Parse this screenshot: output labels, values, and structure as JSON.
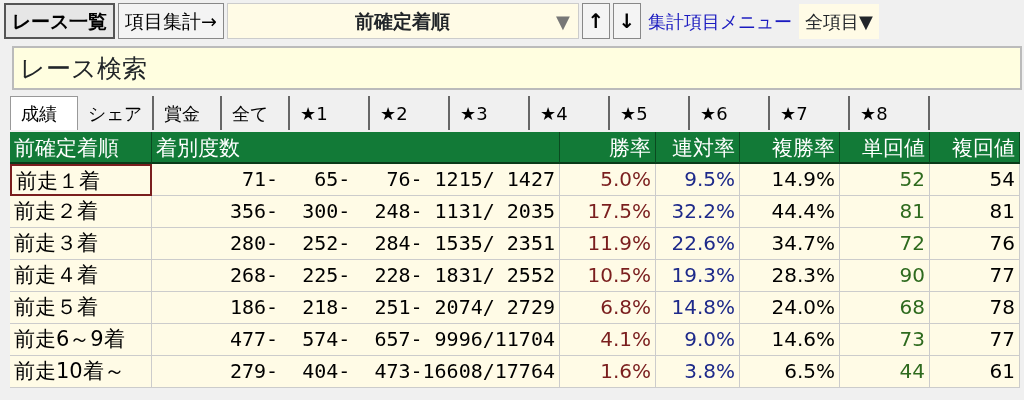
{
  "toolbar": {
    "buttons": [
      {
        "label": "レース一覧",
        "selected": true
      },
      {
        "label": "項目集計→",
        "selected": false
      }
    ],
    "sort_field": {
      "value": "前確定着順",
      "arrow": "▼"
    },
    "sort_buttons": [
      "↑",
      "↓"
    ],
    "menu_link": "集計項目メニュー",
    "all_items": "全項目▼"
  },
  "search": {
    "value": "レース検索"
  },
  "tabs": [
    {
      "label": "成績",
      "selected": true
    },
    {
      "label": "シェア",
      "selected": false
    },
    {
      "label": "賞金",
      "selected": false
    },
    {
      "label": "全て",
      "selected": false
    },
    {
      "label": "★1",
      "selected": false
    },
    {
      "label": "★2",
      "selected": false
    },
    {
      "label": "★3",
      "selected": false
    },
    {
      "label": "★4",
      "selected": false
    },
    {
      "label": "★5",
      "selected": false
    },
    {
      "label": "★6",
      "selected": false
    },
    {
      "label": "★7",
      "selected": false
    },
    {
      "label": "★8",
      "selected": false
    }
  ],
  "table": {
    "columns": [
      {
        "label": "前確定着順",
        "color": "#000000"
      },
      {
        "label": "着別度数",
        "color": "#000000"
      },
      {
        "label": "勝率",
        "color": "#7a1e1e"
      },
      {
        "label": "連対率",
        "color": "#1e2a8a"
      },
      {
        "label": "複勝率",
        "color": "#000000"
      },
      {
        "label": "単回値",
        "color": "#2e6a1e"
      },
      {
        "label": "複回値",
        "color": "#000000"
      }
    ],
    "rows": [
      {
        "selected": true,
        "cells": [
          "前走１着",
          "  71-   65-   76- 1215/ 1427",
          "5.0%",
          "9.5%",
          "14.9%",
          "52",
          "54"
        ]
      },
      {
        "selected": false,
        "cells": [
          "前走２着",
          " 356-  300-  248- 1131/ 2035",
          "17.5%",
          "32.2%",
          "44.4%",
          "81",
          "81"
        ]
      },
      {
        "selected": false,
        "cells": [
          "前走３着",
          " 280-  252-  284- 1535/ 2351",
          "11.9%",
          "22.6%",
          "34.7%",
          "72",
          "76"
        ]
      },
      {
        "selected": false,
        "cells": [
          "前走４着",
          " 268-  225-  228- 1831/ 2552",
          "10.5%",
          "19.3%",
          "28.3%",
          "90",
          "77"
        ]
      },
      {
        "selected": false,
        "cells": [
          "前走５着",
          " 186-  218-  251- 2074/ 2729",
          "6.8%",
          "14.8%",
          "24.0%",
          "68",
          "78"
        ]
      },
      {
        "selected": false,
        "cells": [
          "前走6～9着",
          " 477-  574-  657- 9996/11704",
          "4.1%",
          "9.0%",
          "14.6%",
          "73",
          "77"
        ]
      },
      {
        "selected": false,
        "cells": [
          "前走10着～",
          " 279-  404-  473-16608/17764",
          "1.6%",
          "3.8%",
          "6.5%",
          "44",
          "61"
        ]
      }
    ]
  }
}
